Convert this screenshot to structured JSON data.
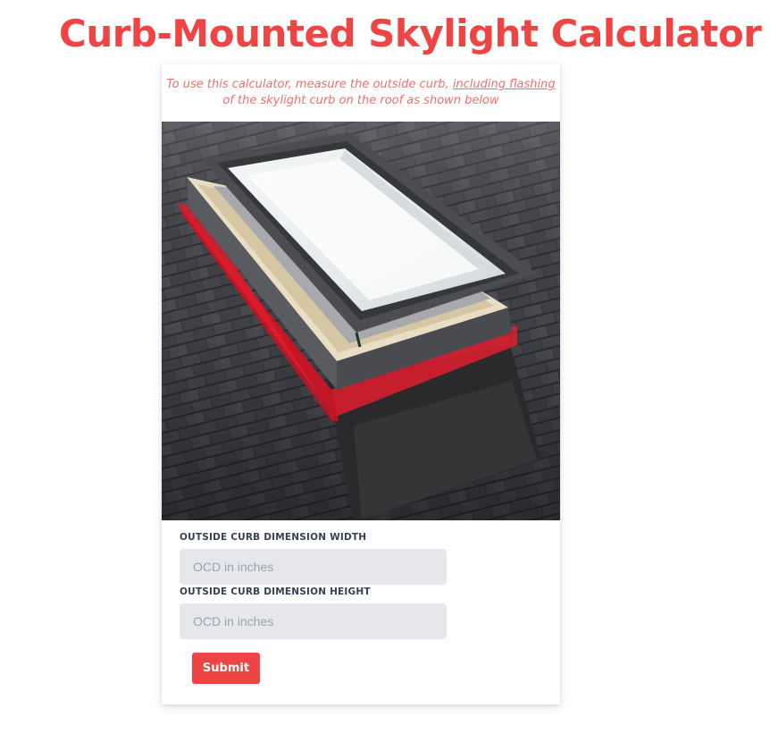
{
  "page": {
    "title": "Curb-Mounted Skylight Calculator"
  },
  "instructions": {
    "part1": "To use this calculator, measure the outside curb, ",
    "underlined": "including flashing",
    "part2": " of the skylight curb on the roof as shown below"
  },
  "image": {
    "subject": "skylight-on-shingle-roof",
    "highlight_color": "#e11d2e"
  },
  "form": {
    "width_label": "OUTSIDE CURB DIMENSION WIDTH",
    "width_placeholder": "OCD in inches",
    "height_label": "OUTSIDE CURB DIMENSION HEIGHT",
    "height_placeholder": "OCD in inches",
    "submit_label": "Submit"
  },
  "colors": {
    "accent": "#ef4444",
    "input_bg": "#e5e7eb",
    "label": "#374151"
  }
}
